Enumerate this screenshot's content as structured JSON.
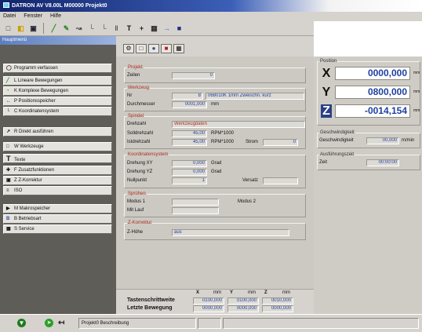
{
  "window": {
    "title": "DATRON AV V8.00L   M00000   Projekt0"
  },
  "menu": [
    "Datei",
    "Fenster",
    "Hilfe"
  ],
  "toolbar": {
    "tools": [
      "new-icon",
      "open-icon",
      "save-icon",
      "tool-icon",
      "edit-icon",
      "path-icon",
      "line-icon",
      "line-icon",
      "t-icon",
      "text-t-icon",
      "plus-icon",
      "grid-icon",
      "arrow-icon",
      "magnet-icon"
    ]
  },
  "leftpanel": {
    "header": "Hauptmenü",
    "items": [
      {
        "icon": "◯",
        "label": "Programm verfassen"
      },
      {
        "icon": "╱",
        "label": "L  Lineare Bewegungen"
      },
      {
        "icon": "◔",
        "label": "K  Komplexe Bewegungen"
      },
      {
        "icon": "←",
        "label": "P  Positionsspeicher"
      },
      {
        "icon": "└",
        "label": "C  Koordinatensystem"
      },
      {
        "icon": "↗",
        "label": "R  Direkt ausführen"
      },
      {
        "icon": "□",
        "label": "W  Werkzeuge"
      },
      {
        "icon": "T",
        "label": "Texte"
      },
      {
        "icon": "✚",
        "label": "F  Zusatzfunktionen"
      },
      {
        "icon": "▣",
        "label": "Z  Z-Korrektur"
      },
      {
        "icon": "≡",
        "label": "ISO"
      },
      {
        "icon": "▶",
        "label": "M  Makrospeicher"
      },
      {
        "icon": "B",
        "label": "B  Betriebsart"
      },
      {
        "icon": "▦",
        "label": "S  Service"
      }
    ]
  },
  "center": {
    "projekt": {
      "title": "Projekt",
      "zeilen_label": "Zeilen",
      "zeilen": "0"
    },
    "werkzeug": {
      "title": "Werkzeug",
      "nr_label": "Nr",
      "nr": "8",
      "name": "068010K 1mm Zweischn. kurz",
      "durchmesser_label": "Durchmesser",
      "durchmesser": "0001,000",
      "unit": "mm"
    },
    "spindel": {
      "title": "Spindel",
      "drehzahl_label": "Drehzahl",
      "drehzahl": "Werkzeugdaten",
      "soll_label": "Solldrehzahl",
      "soll": "45,00",
      "soll_unit": "RPM*1000",
      "ist_label": "Istdrehzahl",
      "ist": "45,00",
      "ist_unit": "RPM*1000",
      "strom_label": "Strom",
      "strom": "0"
    },
    "koordinaten": {
      "title": "Koordinatensystem",
      "dxy_label": "Drehung XY",
      "dxy": "0,000",
      "dxy_unit": "Grad",
      "dyz_label": "Drehung YZ",
      "dyz": "0,000",
      "dyz_unit": "Grad",
      "null_label": "Nullpunkt",
      "null": "1",
      "versatz_label": "Versatz",
      "versatz": ""
    },
    "spruehen": {
      "title": "Sprühen",
      "m1_label": "Modus 1",
      "m1": "",
      "m2_label": "Modus 2",
      "m2": "",
      "lauf_label": "Mit Lauf",
      "lauf": ""
    },
    "zkorr": {
      "title": "Z-Korrektur",
      "hoehe_label": "Z-Höhe",
      "hoehe": "aus"
    }
  },
  "right": {
    "position_title": "Position",
    "axes": [
      {
        "axis": "X",
        "value": "0000,000",
        "unit": "mm",
        "color": "#111111",
        "bg": "#cfccc6"
      },
      {
        "axis": "Y",
        "value": "0800,000",
        "unit": "mm",
        "color": "#111111",
        "bg": "#cfccc6"
      },
      {
        "axis": "Z",
        "value": "-0014,154",
        "unit": "mm",
        "color": "#ffffff",
        "bg": "#2a3f86"
      }
    ],
    "geschw_title": "Geschwindigkeit",
    "geschw_label": "Geschwindigkeit",
    "geschw_value": "00,000",
    "geschw_unit": "m/min",
    "zeit_title": "Ausführungszeit",
    "zeit_label": "Zeit",
    "zeit_value": "00:00:00"
  },
  "steps": {
    "x_head": "X",
    "x_unit": "mm",
    "y_head": "Y",
    "y_unit": "mm",
    "z_head": "Z",
    "z_unit": "mm",
    "row1_label": "Tastenschrittweite",
    "row1": [
      "0100,000",
      "0100,000",
      "0010,000"
    ],
    "row2_label": "Letzte Bewegung",
    "row2": [
      "0000,000",
      "0000,000",
      "0000,000"
    ]
  },
  "status": {
    "text": "Projekt0 Beschreibung"
  }
}
